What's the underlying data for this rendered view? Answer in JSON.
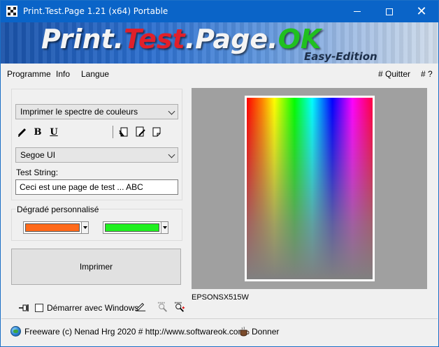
{
  "window": {
    "title": "Print.Test.Page 1.21  (x64) Portable"
  },
  "banner": {
    "logo_parts": [
      "Print",
      ".",
      "Test",
      ".",
      "Page",
      ".",
      "OK"
    ],
    "edition": "Easy-Edition"
  },
  "menu": {
    "left": [
      "Programme",
      "Info",
      "Langue"
    ],
    "quit": "# Quitter",
    "help": "# ?"
  },
  "mode": {
    "selected": "Imprimer le spectre de couleurs"
  },
  "font": {
    "selected": "Segoe UI",
    "bold_label": "B",
    "underline_label": "U"
  },
  "test_string": {
    "label": "Test String:",
    "value": "Ceci est une page de test ... ABC"
  },
  "gradient": {
    "label": "Dégradé personnalisé",
    "color1": "#ff6a1a",
    "color2": "#20f020"
  },
  "print_button": "Imprimer",
  "preview": {
    "printer": "EPSONSX515W"
  },
  "bottom": {
    "autostart_label": "Démarrer avec Windows",
    "autostart_checked": false
  },
  "footer": {
    "text": "Freeware (c) Nenad Hrg 2020 # http://www.softwareok.com",
    "donate": "Donner"
  },
  "colors": {
    "titlebar": "#0a64c8",
    "preview_bg": "#a0a0a0"
  }
}
